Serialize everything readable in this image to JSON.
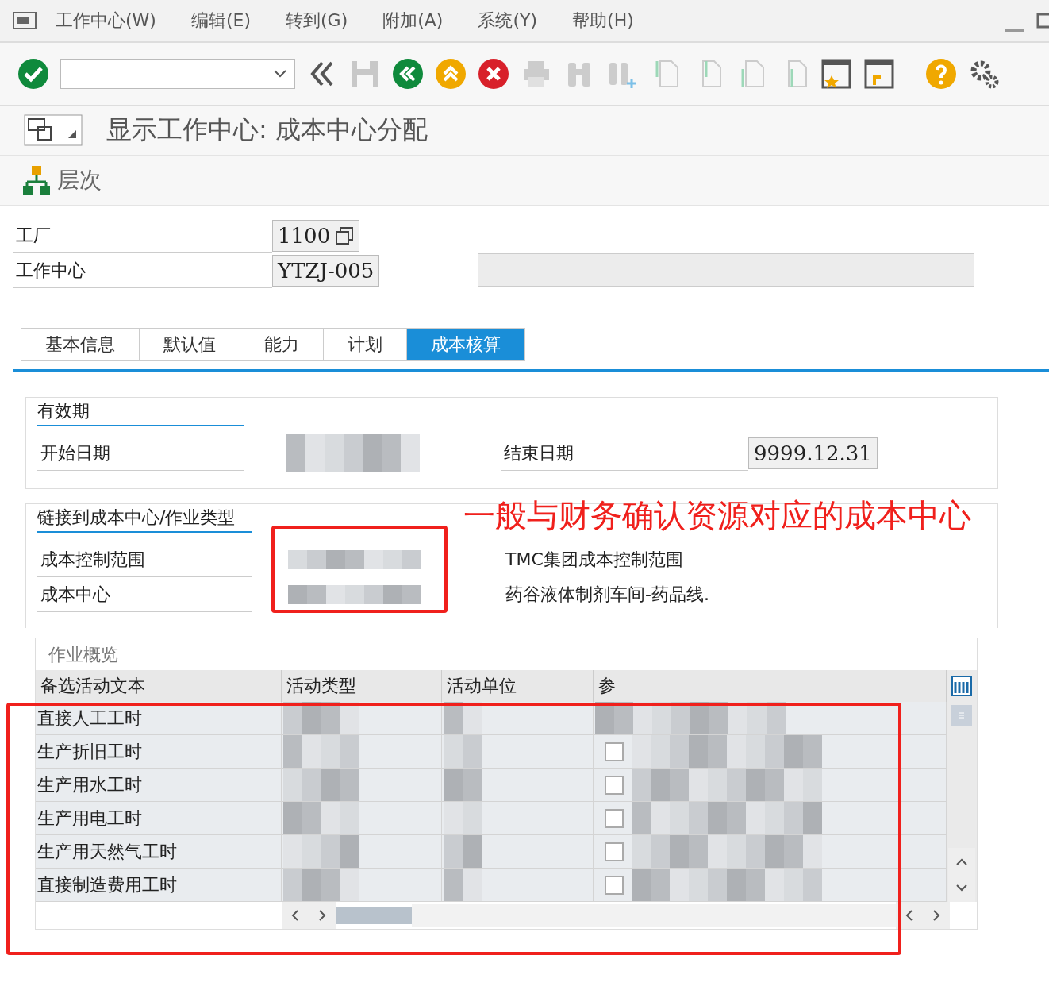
{
  "menu": [
    "工作中心(W)",
    "编辑(E)",
    "转到(G)",
    "附加(A)",
    "系统(Y)",
    "帮助(H)"
  ],
  "title": "显示工作中心: 成本中心分配",
  "section": "层次",
  "header_fields": [
    {
      "label": "工厂",
      "value": "1100",
      "has_help": true
    },
    {
      "label": "工作中心",
      "value": "YTZJ-005",
      "has_help": false
    }
  ],
  "tabs": [
    {
      "label": "基本信息",
      "selected": false
    },
    {
      "label": "默认值",
      "selected": false
    },
    {
      "label": "能力",
      "selected": false
    },
    {
      "label": "计划",
      "selected": false
    },
    {
      "label": "成本核算",
      "selected": true
    }
  ],
  "validity": {
    "title": "有效期",
    "start_label": "开始日期",
    "end_label": "结束日期",
    "end_value": "9999.12.31"
  },
  "link": {
    "title": "链接到成本中心/作业类型",
    "fields": [
      {
        "label": "成本控制范围",
        "description": "TMC集团成本控制范围"
      },
      {
        "label": "成本中心",
        "description": "药谷液体制剂车间-药品线."
      }
    ]
  },
  "annotation": "一般与财务确认资源对应的成本中心",
  "activities": {
    "title": "作业概览",
    "columns": [
      "备选活动文本",
      "活动类型",
      "活动单位",
      "参"
    ],
    "rows": [
      {
        "text": "直接人工工时"
      },
      {
        "text": "生产折旧工时",
        "checked": false
      },
      {
        "text": "生产用水工时",
        "checked": false
      },
      {
        "text": "生产用电工时",
        "checked": false
      },
      {
        "text": "生产用天然气工时",
        "checked": false
      },
      {
        "text": "直接制造费用工时",
        "checked": false
      }
    ]
  }
}
